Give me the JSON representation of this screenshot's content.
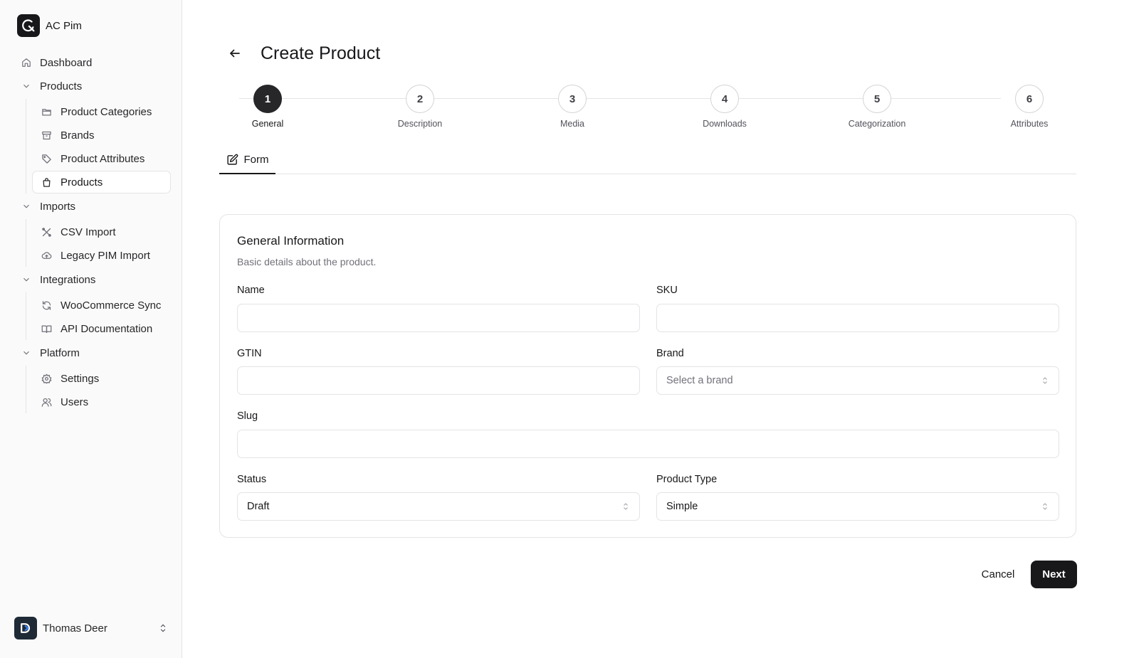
{
  "app": {
    "name": "AC Pim"
  },
  "sidebar": {
    "dashboard": "Dashboard",
    "groups": [
      {
        "label": "Products",
        "items": [
          {
            "label": "Product Categories",
            "icon": "folder-icon"
          },
          {
            "label": "Brands",
            "icon": "archive-icon"
          },
          {
            "label": "Product Attributes",
            "icon": "tag-icon"
          },
          {
            "label": "Products",
            "icon": "shopping-bag-icon",
            "active": true
          }
        ]
      },
      {
        "label": "Imports",
        "items": [
          {
            "label": "CSV Import",
            "icon": "tools-icon"
          },
          {
            "label": "Legacy PIM Import",
            "icon": "cloud-upload-icon"
          }
        ]
      },
      {
        "label": "Integrations",
        "items": [
          {
            "label": "WooCommerce Sync",
            "icon": "refresh-icon"
          },
          {
            "label": "API Documentation",
            "icon": "book-icon"
          }
        ]
      },
      {
        "label": "Platform",
        "items": [
          {
            "label": "Settings",
            "icon": "gear-icon"
          },
          {
            "label": "Users",
            "icon": "users-icon"
          }
        ]
      }
    ],
    "user": {
      "name": "Thomas Deer"
    }
  },
  "page": {
    "title": "Create Product"
  },
  "stepper": {
    "active": 1,
    "steps": [
      {
        "number": "1",
        "label": "General"
      },
      {
        "number": "2",
        "label": "Description"
      },
      {
        "number": "3",
        "label": "Media"
      },
      {
        "number": "4",
        "label": "Downloads"
      },
      {
        "number": "5",
        "label": "Categorization"
      },
      {
        "number": "6",
        "label": "Attributes"
      }
    ]
  },
  "tabs": {
    "form": "Form"
  },
  "form": {
    "title": "General Information",
    "description": "Basic details about the product.",
    "name_label": "Name",
    "name_value": "",
    "sku_label": "SKU",
    "sku_value": "",
    "gtin_label": "GTIN",
    "gtin_value": "",
    "brand_label": "Brand",
    "brand_placeholder": "Select a brand",
    "slug_label": "Slug",
    "slug_value": "",
    "status_label": "Status",
    "status_value": "Draft",
    "product_type_label": "Product Type",
    "product_type_value": "Simple"
  },
  "actions": {
    "cancel": "Cancel",
    "next": "Next"
  },
  "colors": {
    "primary": "#18181b",
    "border": "#e4e4e7",
    "muted_text": "#71717a",
    "sidebar_bg": "#fafafa"
  }
}
